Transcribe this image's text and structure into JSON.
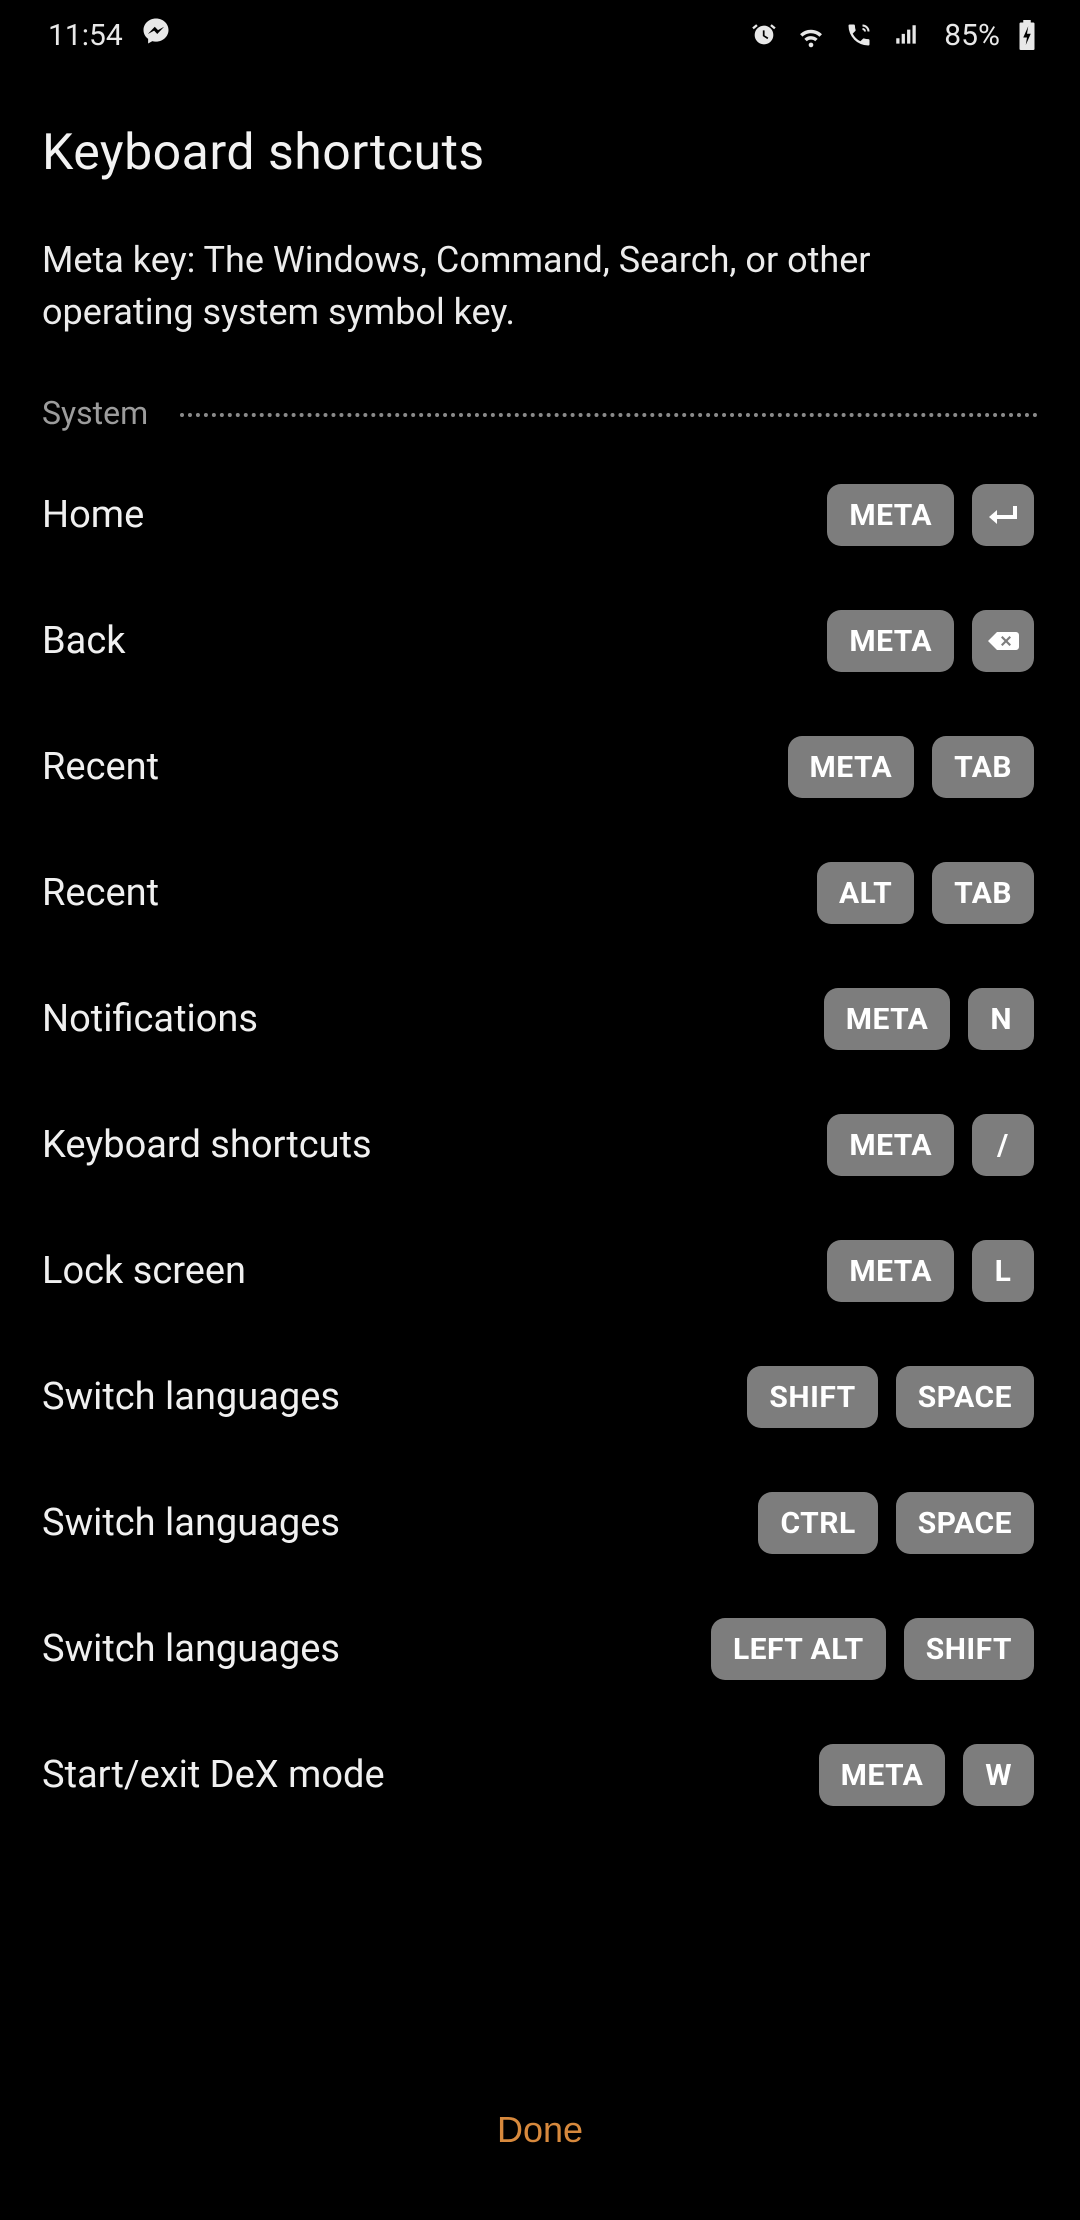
{
  "status": {
    "time": "11:54",
    "battery": "85%"
  },
  "page": {
    "title": "Keyboard shortcuts",
    "subtitle": "Meta key: The Windows, Command, Search, or other operating system symbol key."
  },
  "section": {
    "label": "System"
  },
  "shortcuts": [
    {
      "name": "Home",
      "keys": [
        "META",
        "ENTER_ICON"
      ]
    },
    {
      "name": "Back",
      "keys": [
        "META",
        "BACKSPACE_ICON"
      ]
    },
    {
      "name": "Recent",
      "keys": [
        "META",
        "TAB"
      ]
    },
    {
      "name": "Recent",
      "keys": [
        "ALT",
        "TAB"
      ]
    },
    {
      "name": "Notifications",
      "keys": [
        "META",
        "N"
      ]
    },
    {
      "name": "Keyboard shortcuts",
      "keys": [
        "META",
        "/"
      ]
    },
    {
      "name": "Lock screen",
      "keys": [
        "META",
        "L"
      ]
    },
    {
      "name": "Switch languages",
      "keys": [
        "SHIFT",
        "SPACE"
      ]
    },
    {
      "name": "Switch languages",
      "keys": [
        "CTRL",
        "SPACE"
      ]
    },
    {
      "name": "Switch languages",
      "keys": [
        "LEFT ALT",
        "SHIFT"
      ]
    },
    {
      "name": "Start/exit DeX mode",
      "keys": [
        "META",
        "W"
      ]
    }
  ],
  "footer": {
    "done": "Done"
  }
}
